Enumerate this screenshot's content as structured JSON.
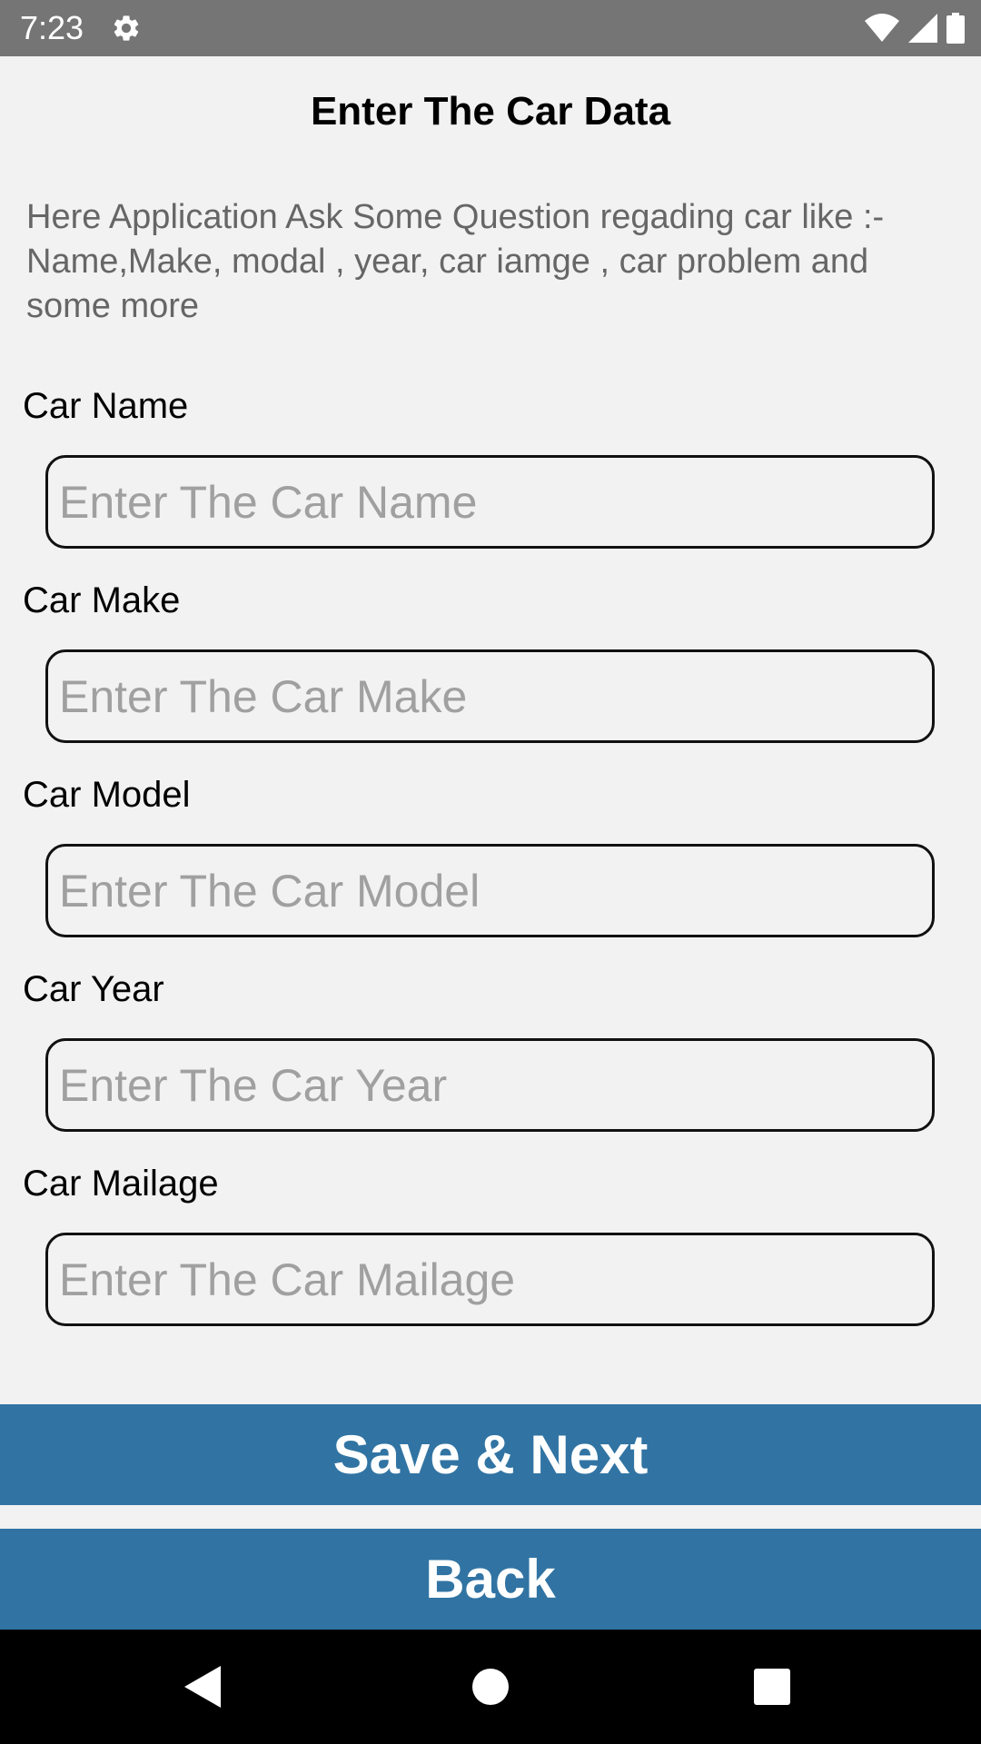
{
  "status_bar": {
    "time": "7:23",
    "icons": [
      "gear-icon",
      "wifi-icon",
      "signal-icon",
      "battery-icon"
    ],
    "background_color": "#757575"
  },
  "header": {
    "title": "Enter The Car Data",
    "description": "Here Application Ask Some Question regading car like :- Name,Make, modal , year, car iamge , car problem and some more"
  },
  "form": {
    "fields": [
      {
        "label": "Car Name",
        "placeholder": "Enter The Car Name",
        "value": ""
      },
      {
        "label": "Car Make",
        "placeholder": "Enter The Car Make",
        "value": ""
      },
      {
        "label": "Car Model",
        "placeholder": "Enter The Car Model",
        "value": ""
      },
      {
        "label": "Car Year",
        "placeholder": "Enter The Car Year",
        "value": ""
      },
      {
        "label": "Car Mailage",
        "placeholder": "Enter The Car Mailage",
        "value": ""
      }
    ]
  },
  "actions": {
    "save_next_label": "Save & Next",
    "back_label": "Back",
    "button_color": "#3174a3"
  },
  "nav_bar": {
    "icons": [
      "back-triangle-icon",
      "home-circle-icon",
      "recents-square-icon"
    ]
  }
}
